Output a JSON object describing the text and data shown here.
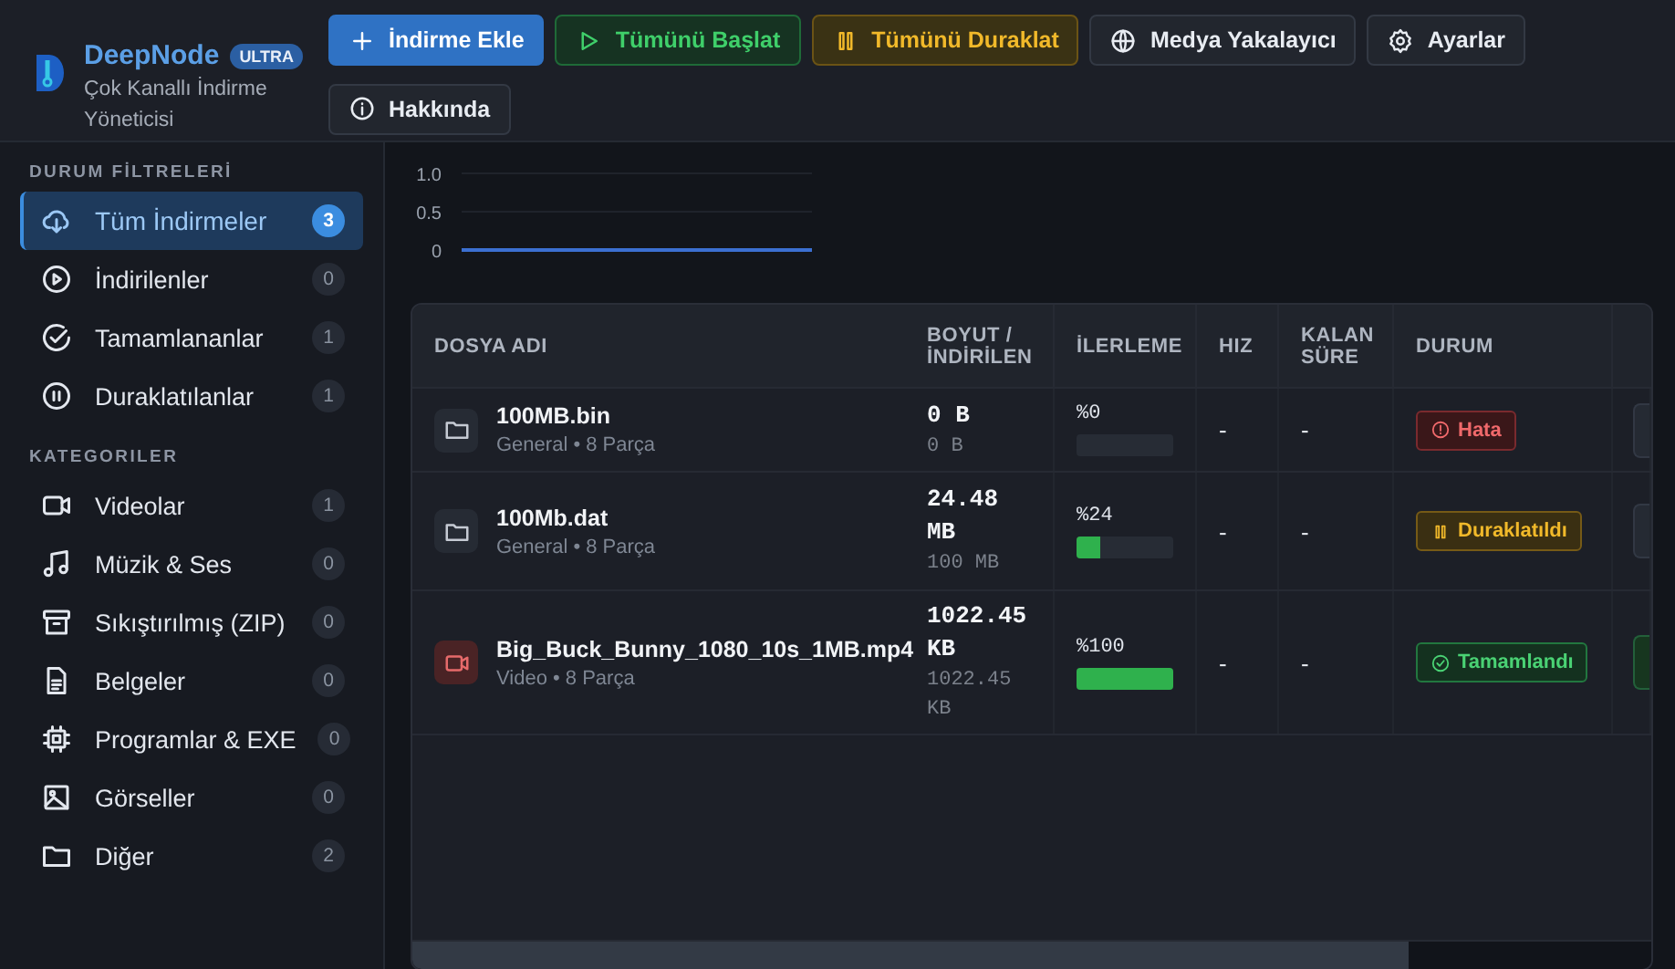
{
  "app": {
    "title": "DeepNode",
    "badge": "ULTRA",
    "subtitle": "Çok Kanallı İndirme Yöneticisi"
  },
  "toolbar": [
    {
      "label": "İndirme Ekle",
      "kind": "primary"
    },
    {
      "label": "Tümünü Başlat",
      "kind": "success"
    },
    {
      "label": "Tümünü Duraklat",
      "kind": "warning"
    },
    {
      "label": "Medya Yakalayıcı",
      "kind": "default"
    },
    {
      "label": "Ayarlar",
      "kind": "default"
    },
    {
      "label": "Hakkında",
      "kind": "default"
    }
  ],
  "sidebar": {
    "sections": [
      {
        "title": "DURUM FİLTRELERİ",
        "items": [
          {
            "label": "Tüm İndirmeler",
            "count": "3",
            "selected": true
          },
          {
            "label": "İndirilenler",
            "count": "0",
            "selected": false
          },
          {
            "label": "Tamamlananlar",
            "count": "1",
            "selected": false
          },
          {
            "label": "Duraklatılanlar",
            "count": "1",
            "selected": false
          }
        ]
      },
      {
        "title": "KATEGORILER",
        "items": [
          {
            "label": "Videolar",
            "count": "1",
            "selected": false
          },
          {
            "label": "Müzik & Ses",
            "count": "0",
            "selected": false
          },
          {
            "label": "Sıkıştırılmış (ZIP)",
            "count": "0",
            "selected": false
          },
          {
            "label": "Belgeler",
            "count": "0",
            "selected": false
          },
          {
            "label": "Programlar & EXE",
            "count": "0",
            "selected": false
          },
          {
            "label": "Görseller",
            "count": "0",
            "selected": false
          },
          {
            "label": "Diğer",
            "count": "2",
            "selected": false
          }
        ]
      }
    ]
  },
  "speed_chart": {
    "y_labels": [
      "1.0",
      "0.5",
      "0"
    ]
  },
  "table": {
    "columns": [
      "DOSYA ADI",
      "BOYUT / İNDİRİLEN",
      "İLERLEME",
      "HIZ",
      "KALAN SÜRE",
      "DURUM"
    ],
    "rows": [
      {
        "name": "100MB.bin",
        "meta": "General • 8 Parça",
        "kind": "file",
        "size": "0 B",
        "downloaded": "0 B",
        "progress": "%0",
        "level": 0,
        "speed": "-",
        "remaining": "-",
        "status": {
          "label": "Hata",
          "kind": "error"
        }
      },
      {
        "name": "100Mb.dat",
        "meta": "General • 8 Parça",
        "kind": "file",
        "size": "24.48 MB",
        "downloaded": "100 MB",
        "progress": "%24",
        "level": 0.24,
        "speed": "-",
        "remaining": "-",
        "status": {
          "label": "Duraklatıldı",
          "kind": "paused"
        }
      },
      {
        "name": "Big_Buck_Bunny_1080_10s_1MB.mp4",
        "meta": "Video • 8 Parça",
        "kind": "video",
        "size": "1022.45 KB",
        "downloaded": "1022.45 KB",
        "progress": "%100",
        "level": 1,
        "speed": "-",
        "remaining": "-",
        "status": {
          "label": "Tamamlandı",
          "kind": "done"
        }
      }
    ]
  }
}
